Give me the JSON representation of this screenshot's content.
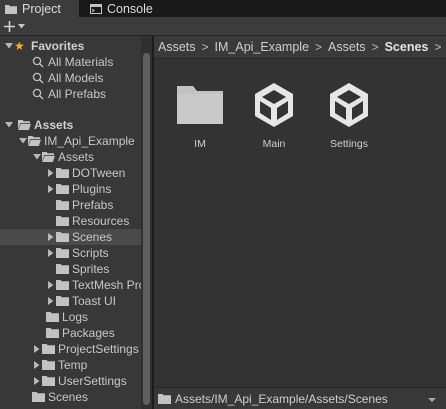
{
  "tabs": [
    {
      "label": "Project",
      "icon": "folder-icon",
      "active": true
    },
    {
      "label": "Console",
      "icon": "console-icon",
      "active": false
    }
  ],
  "toolbar": {
    "create_label": "+",
    "create_icon": "plus-icon"
  },
  "tree": {
    "favorites": {
      "label": "Favorites",
      "items": [
        "All Materials",
        "All Models",
        "All Prefabs"
      ]
    },
    "rows": [
      {
        "label": "Assets"
      },
      {
        "label": "IM_Api_Example"
      },
      {
        "label": "Assets"
      },
      {
        "label": "DOTween"
      },
      {
        "label": "Plugins"
      },
      {
        "label": "Prefabs"
      },
      {
        "label": "Resources"
      },
      {
        "label": "Scenes"
      },
      {
        "label": "Scripts"
      },
      {
        "label": "Sprites"
      },
      {
        "label": "TextMesh Pro"
      },
      {
        "label": "Toast UI"
      },
      {
        "label": "Logs"
      },
      {
        "label": "Packages"
      },
      {
        "label": "ProjectSettings"
      },
      {
        "label": "Temp"
      },
      {
        "label": "UserSettings"
      },
      {
        "label": "Scenes"
      }
    ]
  },
  "breadcrumb": [
    "Assets",
    "IM_Api_Example",
    "Assets",
    "Scenes"
  ],
  "assets": [
    {
      "name": "IM",
      "icon": "folder-icon"
    },
    {
      "name": "Main",
      "icon": "unity-scene-icon"
    },
    {
      "name": "Settings",
      "icon": "unity-scene-icon"
    }
  ],
  "status": {
    "path": "Assets/IM_Api_Example/Assets/Scenes"
  },
  "colors": {
    "favorite_star": "#f0b323",
    "panel": "#383838",
    "content": "#333333"
  }
}
